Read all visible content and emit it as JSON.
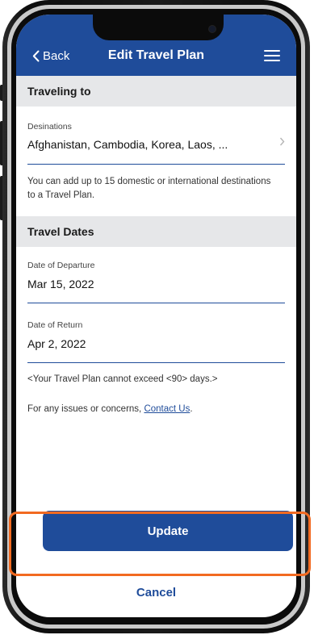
{
  "header": {
    "back_label": "Back",
    "title": "Edit Travel Plan"
  },
  "traveling_to": {
    "section_title": "Traveling to",
    "destinations_label": "Desinations",
    "destinations_value": "Afghanistan, Cambodia, Korea, Laos, ...",
    "helper": "You can add up to 15 domestic or international destinations to a Travel Plan."
  },
  "travel_dates": {
    "section_title": "Travel Dates",
    "departure_label": "Date of Departure",
    "departure_value": "Mar 15, 2022",
    "return_label": "Date of Return",
    "return_value": "Apr 2, 2022",
    "limit_note": "<Your Travel Plan cannot exceed <90> days.>"
  },
  "contact": {
    "prefix": "For any issues or concerns, ",
    "link": "Contact Us",
    "suffix": "."
  },
  "actions": {
    "update_label": "Update",
    "cancel_label": "Cancel"
  },
  "colors": {
    "brand": "#1f4c9a",
    "highlight": "#f26a21"
  }
}
